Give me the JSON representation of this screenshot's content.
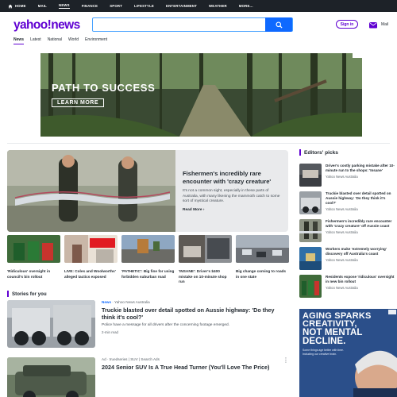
{
  "topnav": {
    "items": [
      {
        "label": "HOME"
      },
      {
        "label": "MAIL"
      },
      {
        "label": "NEWS",
        "active": true
      },
      {
        "label": "FINANCE"
      },
      {
        "label": "SPORT"
      },
      {
        "label": "LIFESTYLE"
      },
      {
        "label": "ENTERTAINMENT"
      },
      {
        "label": "WEATHER"
      },
      {
        "label": "MORE..."
      }
    ]
  },
  "header": {
    "logo_yahoo": "yahoo",
    "logo_slash": "/",
    "logo_news": "news",
    "search": {
      "placeholder": "",
      "value": "",
      "icon": "search-icon"
    },
    "signin_label": "Sign in",
    "mail_label": "Mail",
    "brand_color": "#6001d2",
    "search_button_color": "#0f69ff"
  },
  "subnav": {
    "items": [
      {
        "label": "News",
        "active": true
      },
      {
        "label": "Latest"
      },
      {
        "label": "National"
      },
      {
        "label": "World"
      },
      {
        "label": "Environment"
      }
    ]
  },
  "banner_ad": {
    "title": "PATH TO SUCCESS",
    "button_label": "LEARN MORE"
  },
  "hero": {
    "title": "Fishermen's incredibly rare encounter with 'crazy creature'",
    "description": "It's not a common sight, especially in these parts of Australia, with many likening the mammoth catch to some sort of mystical creature.",
    "read_more": "Read More ›"
  },
  "thumbs": [
    {
      "caption": "'Ridiculous' oversight in council's bin rollout"
    },
    {
      "caption": "LIVE: Coles and Woolworths' alleged tactics exposed"
    },
    {
      "caption": "'PATHETIC': Big fine for using forbidden suburban road"
    },
    {
      "caption": "'INSANE': Driver's $400 mistake on 10-minute shop run"
    },
    {
      "caption": "Big change coming to roads in one state"
    }
  ],
  "stories_heading": "Stories for you",
  "stories": [
    {
      "tag": "News",
      "source": "Yahoo News Australia",
      "separator": "·",
      "title": "Truckie blasted over detail spotted on Aussie highway: 'Do they think it's cool?'",
      "description": "Police have a message for all drivers after the concerning footage emerged.",
      "read_time": "2-min read"
    },
    {
      "tag": "Ad",
      "source": "truedseries | SUV | Search Ads",
      "separator": "·",
      "title": "2024 Senior SUV Is A True Head Turner (You'll Love The Price)",
      "menu_icon": "more-vertical-icon"
    }
  ],
  "editors_picks": {
    "heading": "Editors' picks",
    "items": [
      {
        "title": "Driver's costly parking mistake after 10-minute run to the shops: 'Insane'",
        "source": "Yahoo News Australia"
      },
      {
        "title": "Truckie blasted over detail spotted on Aussie highway: 'Do they think it's cool?'",
        "source": "Yahoo News Australia"
      },
      {
        "title": "Fishermen's incredibly rare encounter with 'crazy creature' off Aussie coast",
        "source": "Yahoo News Australia"
      },
      {
        "title": "Workers make 'extremely worrying' discovery off Australia's coast",
        "source": "Yahoo News Australia"
      },
      {
        "title": "Residents expose 'ridiculous' oversight in new bin rollout",
        "source": "Yahoo News Australia"
      }
    ]
  },
  "right_ad": {
    "line1": "AGING SPARKS",
    "line2": "CREATIVITY,",
    "line3": "NOT MENTAL",
    "line4": "DECLINE.",
    "sub": "Some things age better with time. Including our creative brain."
  }
}
